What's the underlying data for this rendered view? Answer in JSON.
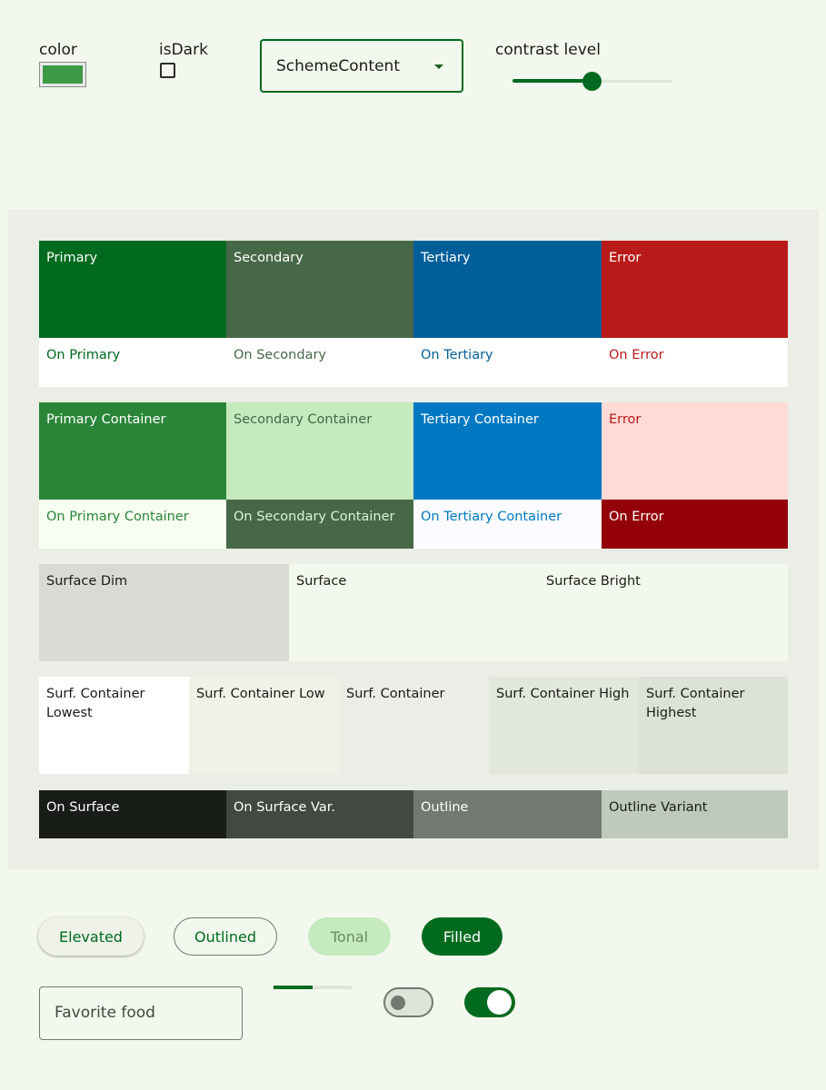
{
  "controls": {
    "color_label": "color",
    "color_value": "#3c9a46",
    "isdark_label": "isDark",
    "isdark_checked": false,
    "scheme_value": "SchemeContent",
    "contrast_label": "contrast level",
    "contrast_level": 0.5
  },
  "palette": {
    "primary": "Primary",
    "secondary": "Secondary",
    "tertiary": "Tertiary",
    "error": "Error",
    "on_primary": "On Primary",
    "on_secondary": "On Secondary",
    "on_tertiary": "On Tertiary",
    "on_error": "On Error",
    "primary_container": "Primary Container",
    "secondary_container": "Secondary Container",
    "tertiary_container": "Tertiary Container",
    "error_container": "Error",
    "on_primary_container": "On Primary Container",
    "on_secondary_container": "On Secondary Container",
    "on_tertiary_container": "On Tertiary Container",
    "on_error_container": "On Error",
    "surface_dim": "Surface Dim",
    "surface": "Surface",
    "surface_bright": "Surface Bright",
    "surf_container_lowest": "Surf. Container Lowest",
    "surf_container_low": "Surf. Container Low",
    "surf_container": "Surf. Container",
    "surf_container_high": "Surf. Container High",
    "surf_container_highest": "Surf. Container Highest",
    "on_surface": "On Surface",
    "on_surface_var": "On Surface Var.",
    "outline": "Outline",
    "outline_variant": "Outline Variant"
  },
  "colors": {
    "primary": "#006a1e",
    "secondary": "#476847",
    "tertiary": "#005f99",
    "error": "#ba1a1a",
    "primary_container": "#2a8539",
    "secondary_container": "#c4eabe",
    "tertiary_container": "#0079c2",
    "error_container": "#ffdad6",
    "on_error_container": "#93000a",
    "surface_dim": "#d8dbd3",
    "surface": "#f2f8ed",
    "on_surface": "#181d17",
    "on_surface_var": "#414940",
    "outline": "#717970",
    "outline_variant": "#c0c9bd"
  },
  "buttons": {
    "elevated": "Elevated",
    "outlined": "Outlined",
    "tonal": "Tonal",
    "filled": "Filled"
  },
  "textfield": {
    "placeholder": "Favorite food"
  },
  "progress": 0.5,
  "switches": {
    "first_on": false,
    "second_on": true
  }
}
